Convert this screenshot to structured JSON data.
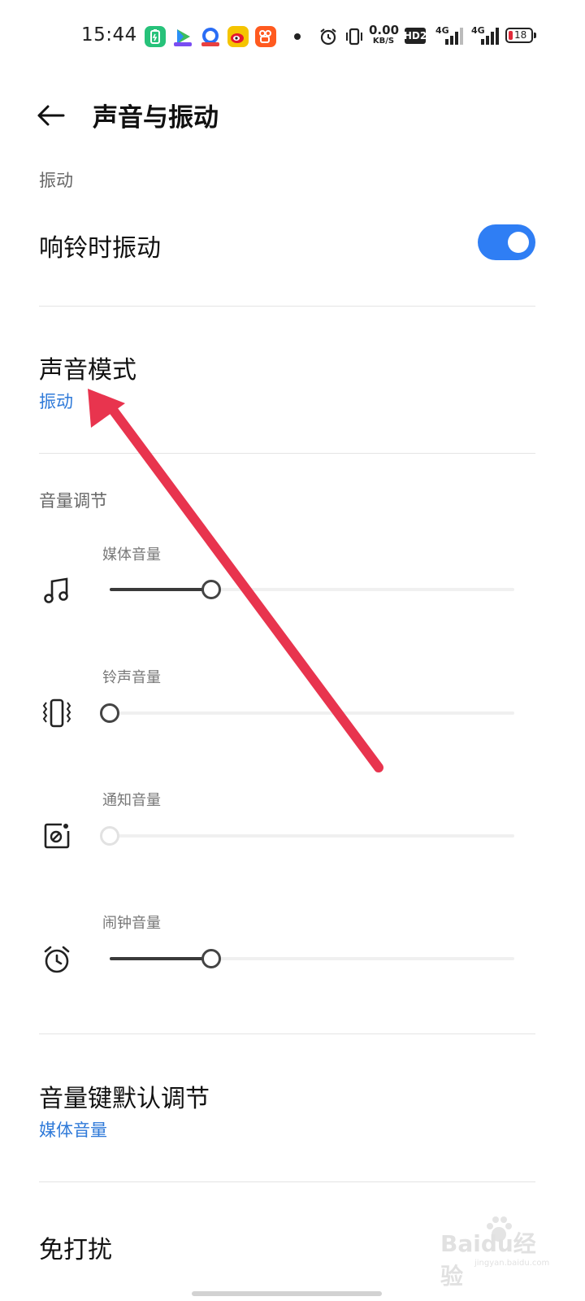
{
  "status_bar": {
    "time": "15:44",
    "net_speed_value": "0.00",
    "net_speed_unit": "KB/S",
    "hd_label": "HD2",
    "signal_1_label": "4G",
    "signal_2_label": "4G",
    "battery_level": "18",
    "app_icons": [
      "battery-saver-app-icon",
      "video-app-icon",
      "browser-app-icon",
      "weibo-app-icon",
      "kuaishou-app-icon"
    ]
  },
  "header": {
    "title": "声音与振动"
  },
  "vibration_section": {
    "label": "振动",
    "vibrate_on_ring": {
      "label": "响铃时振动",
      "enabled": true
    }
  },
  "sound_mode": {
    "title": "声音模式",
    "value": "振动"
  },
  "volume_section": {
    "label": "音量调节",
    "items": [
      {
        "label": "媒体音量",
        "icon": "music-note-icon",
        "level": 0.25,
        "enabled": true
      },
      {
        "label": "铃声音量",
        "icon": "vibrate-phone-icon",
        "level": 0.0,
        "enabled": true
      },
      {
        "label": "通知音量",
        "icon": "notification-off-icon",
        "level": 0.0,
        "enabled": false
      },
      {
        "label": "闹钟音量",
        "icon": "alarm-clock-icon",
        "level": 0.25,
        "enabled": true
      }
    ]
  },
  "volume_key_default": {
    "title": "音量键默认调节",
    "value": "媒体音量"
  },
  "dnd": {
    "title": "免打扰"
  },
  "watermark": {
    "text": "Baidu经验",
    "sub": "jingyan.baidu.com"
  },
  "colors": {
    "accent_blue": "#2f7ad9",
    "toggle_blue": "#2f7ef4",
    "annotation_red": "#e8344e"
  }
}
